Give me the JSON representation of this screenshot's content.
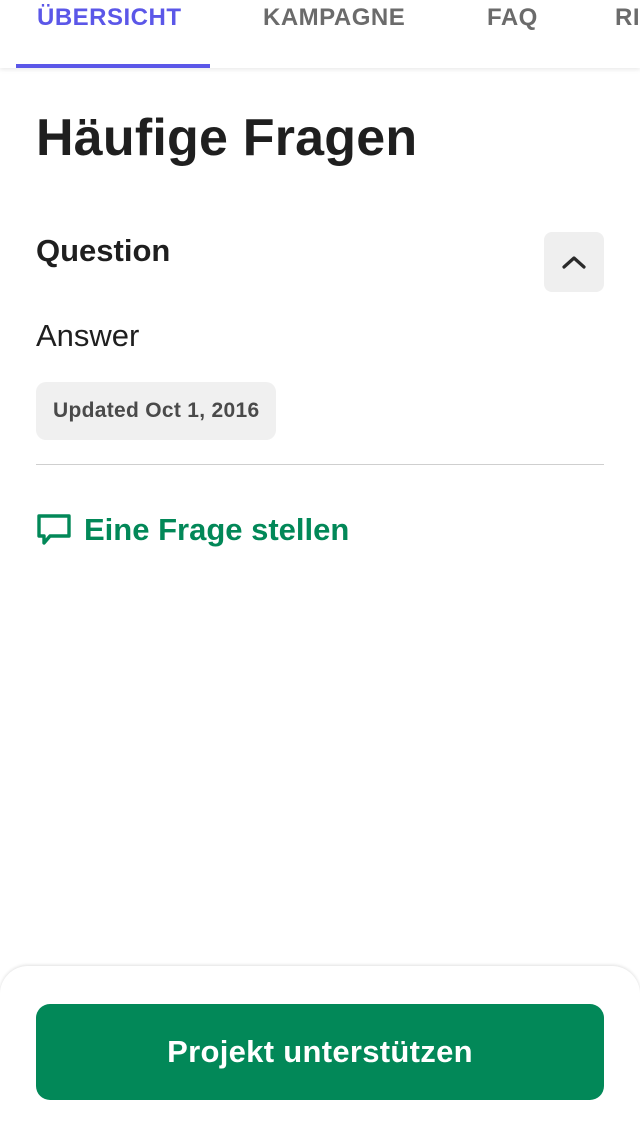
{
  "tabs": [
    {
      "label": "ÜBERSICHT",
      "active": true
    },
    {
      "label": "KAMPAGNE",
      "active": false
    },
    {
      "label": "FAQ",
      "active": false
    },
    {
      "label": "RI",
      "active": false
    }
  ],
  "page_title": "Häufige Fragen",
  "faq": {
    "question": "Question",
    "answer": "Answer",
    "updated": "Updated Oct 1, 2016",
    "toggle_icon": "chevron-up-icon"
  },
  "ask_link": {
    "label": "Eine Frage stellen",
    "icon": "chat-bubble-icon"
  },
  "footer": {
    "button_label": "Projekt unterstützen"
  },
  "colors": {
    "accent": "#5b57e8",
    "green": "#028858",
    "text": "#1f1f1f",
    "muted": "#6b6b6b"
  }
}
